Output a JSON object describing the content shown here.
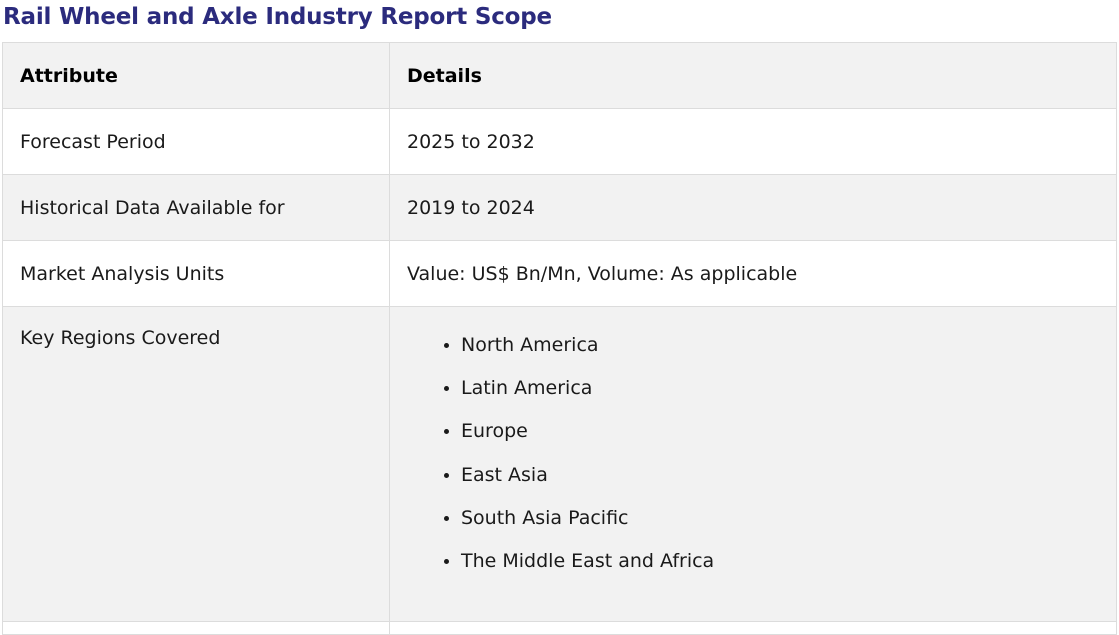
{
  "title": "Rail Wheel and Axle Industry Report Scope",
  "table": {
    "headers": [
      "Attribute",
      "Details"
    ],
    "rows": [
      {
        "attribute": "Forecast Period",
        "details": "2025 to 2032"
      },
      {
        "attribute": "Historical Data Available for",
        "details": "2019 to 2024"
      },
      {
        "attribute": "Market Analysis Units",
        "details": "Value: US$ Bn/Mn, Volume: As applicable"
      }
    ],
    "regions": {
      "attribute": "Key Regions Covered",
      "items": [
        "North America",
        "Latin America",
        "Europe",
        "East Asia",
        "South Asia Pacific",
        "The Middle East and Africa"
      ]
    }
  },
  "colors": {
    "title": "#2b2b7d",
    "header_bg": "#f2f2f2",
    "stripe_bg": "#f2f2f2",
    "border": "#dcdcdc"
  }
}
